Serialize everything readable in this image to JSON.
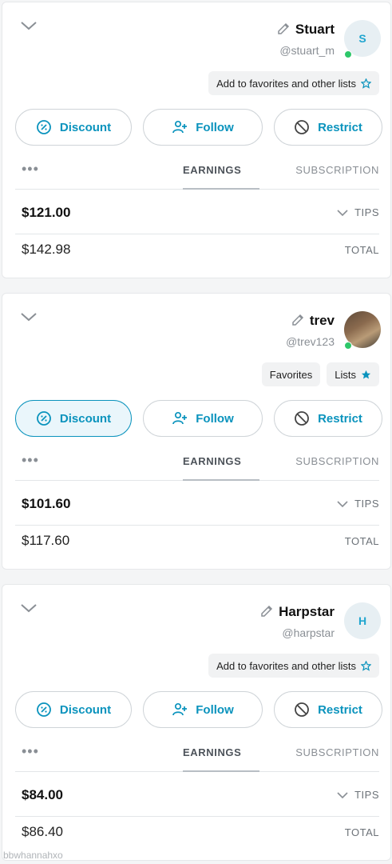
{
  "cards": [
    {
      "avatar_initial": "S",
      "avatar_photo": false,
      "online": true,
      "name": "Stuart",
      "handle": "@stuart_m",
      "chips": [
        {
          "icon": "star-outline-icon",
          "label": "Add to favorites and other lists"
        }
      ],
      "buttons": {
        "discount": "Discount",
        "follow": "Follow",
        "restrict": "Restrict",
        "discount_active": false
      },
      "tabs": {
        "more": "•••",
        "earnings": "EARNINGS",
        "subscription": "SUBSCRIPTION"
      },
      "tips_label": "TIPS",
      "tips_amount": "$121.00",
      "total_label": "TOTAL",
      "total_amount": "$142.98"
    },
    {
      "avatar_initial": "",
      "avatar_photo": true,
      "online": true,
      "name": "trev",
      "handle": "@trev123",
      "chips": [
        {
          "icon": "",
          "label": "Favorites"
        },
        {
          "icon": "star-filled-icon",
          "label": "Lists"
        }
      ],
      "buttons": {
        "discount": "Discount",
        "follow": "Follow",
        "restrict": "Restrict",
        "discount_active": true
      },
      "tabs": {
        "more": "•••",
        "earnings": "EARNINGS",
        "subscription": "SUBSCRIPTION"
      },
      "tips_label": "TIPS",
      "tips_amount": "$101.60",
      "total_label": "TOTAL",
      "total_amount": "$117.60"
    },
    {
      "avatar_initial": "H",
      "avatar_photo": false,
      "online": false,
      "name": "Harpstar",
      "handle": "@harpstar",
      "chips": [
        {
          "icon": "star-outline-icon",
          "label": "Add to favorites and other lists"
        }
      ],
      "buttons": {
        "discount": "Discount",
        "follow": "Follow",
        "restrict": "Restrict",
        "discount_active": false
      },
      "tabs": {
        "more": "•••",
        "earnings": "EARNINGS",
        "subscription": "SUBSCRIPTION"
      },
      "tips_label": "TIPS",
      "tips_amount": "$84.00",
      "total_label": "TOTAL",
      "total_amount": "$86.40"
    }
  ],
  "watermark": "bbwhannahxo",
  "colors": {
    "accent": "#0a93bd",
    "online": "#2ec76a",
    "avatar_bg": "#e7eff3"
  }
}
